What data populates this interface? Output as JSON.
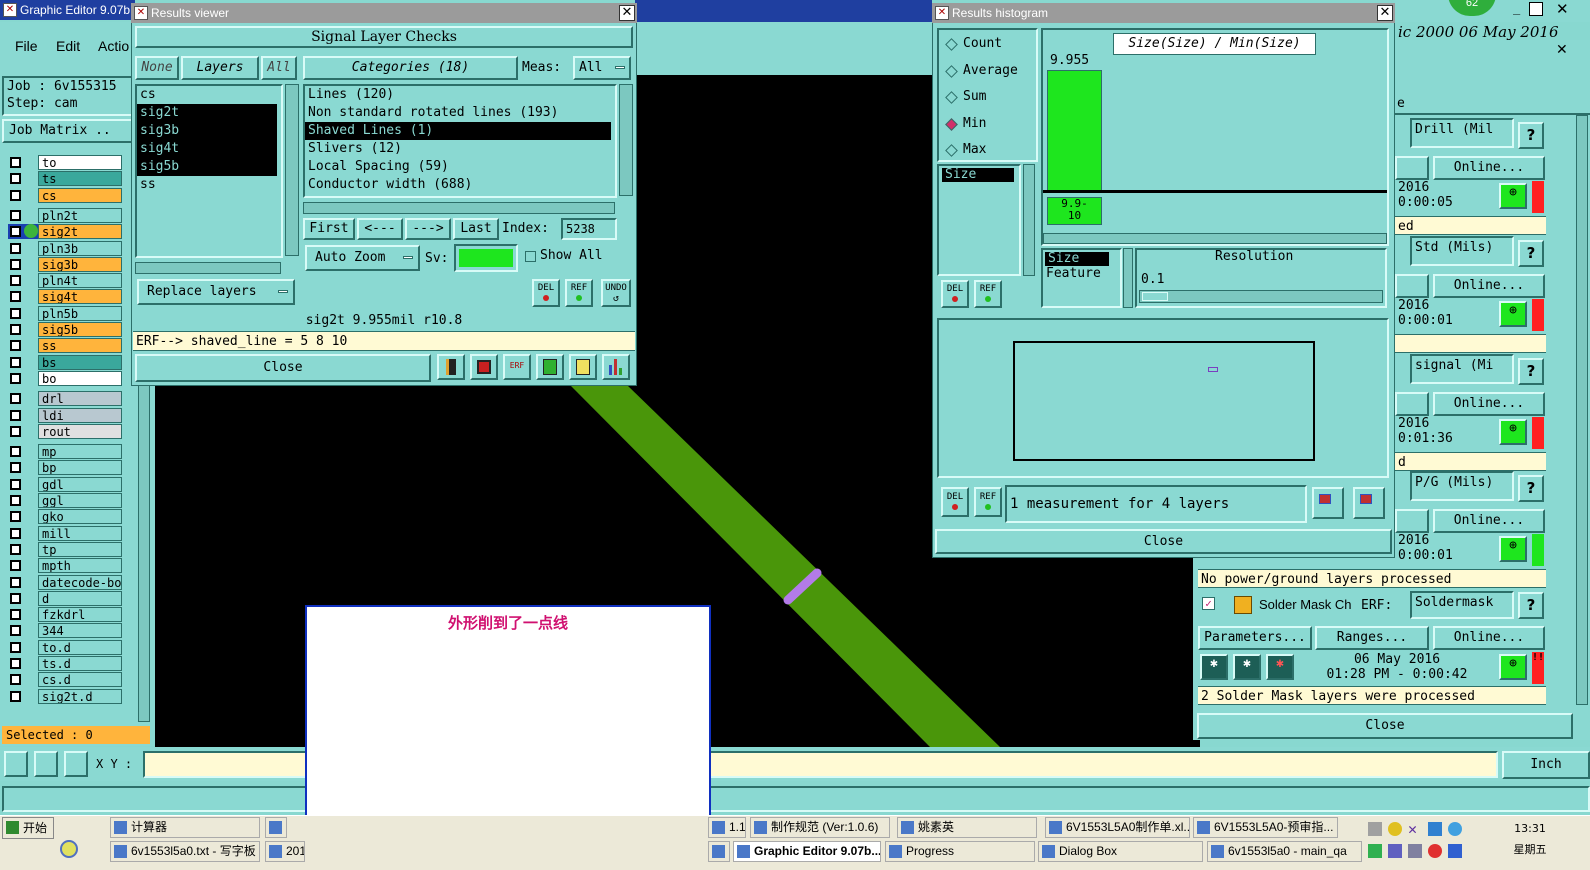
{
  "main_window": {
    "title": "Graphic Editor 9.07b",
    "menu": [
      "File",
      "Edit",
      "Actio"
    ],
    "job_label": "Job : 6v155315",
    "step_label": "Step: cam",
    "job_matrix_button": "Job Matrix ..",
    "selected_label": "Selected : 0",
    "xy_label": "X Y :",
    "units_button": "Inch",
    "header_right_text": "ic 2000 06 May 2016",
    "header_right_badge": "62",
    "layers": [
      {
        "name": "to",
        "color": "#ffffff"
      },
      {
        "name": "ts",
        "color": "#3aa89c"
      },
      {
        "name": "cs",
        "color": "#ffb43c"
      },
      {
        "name": "pln2t",
        "color": "#8ad9d2"
      },
      {
        "name": "sig2t",
        "color": "#ffb43c"
      },
      {
        "name": "pln3b",
        "color": "#8ad9d2"
      },
      {
        "name": "sig3b",
        "color": "#ffb43c"
      },
      {
        "name": "pln4t",
        "color": "#8ad9d2"
      },
      {
        "name": "sig4t",
        "color": "#ffb43c"
      },
      {
        "name": "pln5b",
        "color": "#8ad9d2"
      },
      {
        "name": "sig5b",
        "color": "#ffb43c"
      },
      {
        "name": "ss",
        "color": "#ffb43c"
      },
      {
        "name": "bs",
        "color": "#3aa89c"
      },
      {
        "name": "bo",
        "color": "#ffffff"
      },
      {
        "name": "drl",
        "color": "#b8c8d0"
      },
      {
        "name": "ldi",
        "color": "#b8c8d0"
      },
      {
        "name": "rout",
        "color": "#e0e0e0"
      },
      {
        "name": "mp",
        "color": "#8ad9d2"
      },
      {
        "name": "bp",
        "color": "#8ad9d2"
      },
      {
        "name": "gdl",
        "color": "#8ad9d2"
      },
      {
        "name": "ggl",
        "color": "#8ad9d2"
      },
      {
        "name": "gko",
        "color": "#8ad9d2"
      },
      {
        "name": "mill",
        "color": "#8ad9d2"
      },
      {
        "name": "tp",
        "color": "#8ad9d2"
      },
      {
        "name": "mpth",
        "color": "#8ad9d2"
      },
      {
        "name": "datecode-bo",
        "color": "#8ad9d2"
      },
      {
        "name": "d",
        "color": "#8ad9d2"
      },
      {
        "name": "fzkdrl",
        "color": "#8ad9d2"
      },
      {
        "name": "344",
        "color": "#8ad9d2"
      },
      {
        "name": "to.d",
        "color": "#8ad9d2"
      },
      {
        "name": "ts.d",
        "color": "#8ad9d2"
      },
      {
        "name": "cs.d",
        "color": "#8ad9d2"
      },
      {
        "name": "sig2t.d",
        "color": "#8ad9d2"
      }
    ]
  },
  "results_viewer": {
    "title": "Results viewer",
    "header": "Signal Layer Checks",
    "none_btn": "None",
    "layers_btn": "Layers",
    "all_btn": "All",
    "categories_btn": "Categories (18)",
    "meas_label": "Meas:",
    "meas_value": "All",
    "layer_list": [
      {
        "name": "cs",
        "selected": false
      },
      {
        "name": "sig2t",
        "selected": true
      },
      {
        "name": "sig3b",
        "selected": true
      },
      {
        "name": "sig4t",
        "selected": true
      },
      {
        "name": "sig5b",
        "selected": true
      },
      {
        "name": "ss",
        "selected": false
      }
    ],
    "categories": [
      {
        "name": "Lines (120)",
        "selected": false
      },
      {
        "name": "Non standard rotated lines (193)",
        "selected": false
      },
      {
        "name": "Shaved Lines (1)",
        "selected": true
      },
      {
        "name": "Slivers (12)",
        "selected": false
      },
      {
        "name": "Local Spacing (59)",
        "selected": false
      },
      {
        "name": "Conductor width (688)",
        "selected": false
      }
    ],
    "first_btn": "First",
    "prev_btn": "<---",
    "next_btn": "--->",
    "last_btn": "Last",
    "index_label": "Index:",
    "index_value": "5238",
    "auto_zoom_btn": "Auto Zoom",
    "sv_label": "Sv:",
    "show_all_label": "Show All",
    "replace_layers_btn": "Replace layers",
    "del_label": "DEL",
    "ref_label": "REF",
    "undo_label": "UNDO",
    "status_line": "sig2t 9.955mil  r10.8",
    "erf_line": "ERF--> shaved_line = 5 8 10",
    "close_btn": "Close"
  },
  "results_histogram": {
    "title": "Results histogram",
    "options": [
      {
        "label": "Count",
        "checked": false
      },
      {
        "label": "Average",
        "checked": false
      },
      {
        "label": "Sum",
        "checked": false
      },
      {
        "label": "Min",
        "checked": true
      },
      {
        "label": "Max",
        "checked": false
      }
    ],
    "measure_list": [
      "Size"
    ],
    "chart_title": "Size(Size) / Min(Size)",
    "bar_value": "9.955",
    "bar_bin_label": "9.9-\n10",
    "bar_color": "#1ee61e",
    "sort_list": [
      "Size",
      "Feature"
    ],
    "resolution_label": "Resolution",
    "resolution_value": "0.1",
    "summary": "1 measurement for 4 layers",
    "del_label": "DEL",
    "ref_label": "REF",
    "close_btn": "Close"
  },
  "analysis_panel": {
    "rows": [
      {
        "field": "Drill (Mil",
        "online": "Online...",
        "date": "2016",
        "time": "0:00:05",
        "status": "ed",
        "flag": "#ff2020"
      },
      {
        "field": "Std (Mils)",
        "online": "Online...",
        "date": "2016",
        "time": "0:00:01",
        "status": "",
        "flag": "#ff2020"
      },
      {
        "field": "signal (Mi",
        "online": "Online...",
        "date": "2016",
        "time": "0:01:36",
        "status": "d",
        "flag": "#ff2020"
      },
      {
        "field": "P/G (Mils)",
        "online": "Online...",
        "date": "2016",
        "time": "0:00:01",
        "status": "No power/ground layers processed",
        "flag": "#1ee61e"
      }
    ],
    "header_tail": "e",
    "solder": {
      "name": "Solder Mask Ch",
      "erf_label": "ERF:",
      "erf_value": "Soldermask",
      "params_btn": "Parameters...",
      "ranges_btn": "Ranges...",
      "online_btn": "Online...",
      "date": "06 May 2016",
      "time": "01:28 PM - 0:00:42",
      "status": "2 Solder Mask layers were processed"
    },
    "close_btn": "Close",
    "help": "?"
  },
  "annotation": {
    "text": "外形削到了一点线"
  },
  "taskbar": {
    "start": "开始",
    "row1": [
      "计算器",
      "",
      "1.1...",
      "制作规范 (Ver:1.0.6)",
      "姚素英",
      "6V1553L5A0制作单.xl...",
      "6V1553L5A0-预审指..."
    ],
    "row2": [
      "6v1553l5a0.txt - 写字板",
      "201",
      "7...",
      "Graphic Editor 9.07b...",
      "Progress",
      "Dialog Box",
      "6v1553l5a0 - main_qa"
    ],
    "time": "13:31",
    "day": "星期五"
  }
}
